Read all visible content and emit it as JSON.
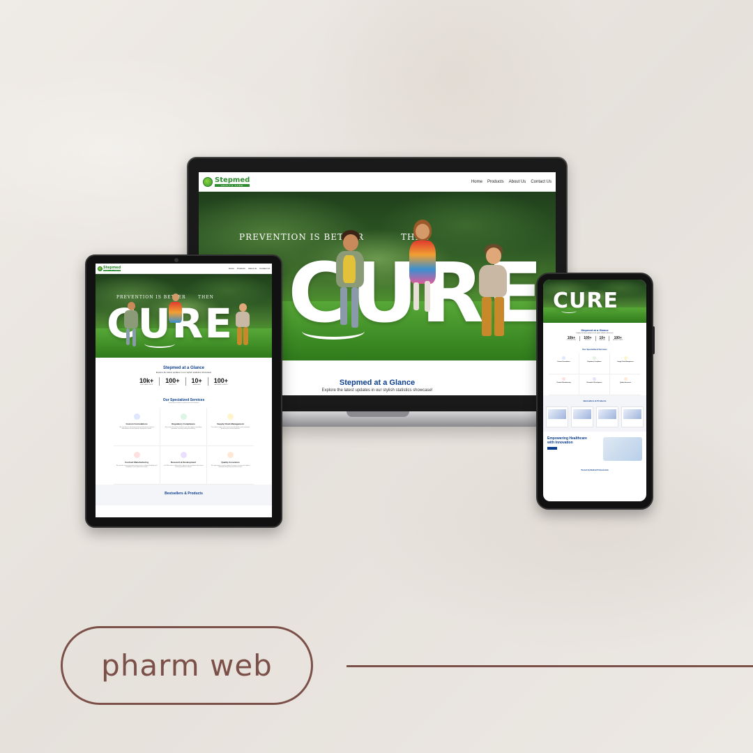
{
  "brand": {
    "name": "Stepmed",
    "tagline": "HEALTH CARE",
    "accent": "#2e8b2f",
    "heading_color": "#0d3f8f"
  },
  "nav": {
    "items": [
      "Home",
      "Products",
      "About Us",
      "Contact Us"
    ]
  },
  "hero": {
    "prevention": "PREVENTION IS BETTER",
    "then": "THEN",
    "cure": "CURE"
  },
  "glance": {
    "title": "Stepmed at a Glance",
    "subtitle": "Explore the latest updates in our stylish statistics showcase!",
    "stats": [
      {
        "value": "10k+",
        "label": "Customer Visits"
      },
      {
        "value": "100+",
        "label": "Products"
      },
      {
        "value": "10+",
        "label": "Branches"
      },
      {
        "value": "100+",
        "label": "Satisfied Clients"
      }
    ]
  },
  "services": {
    "title": "Our Specialized Services",
    "subtitle": "Delivering excellence in pharmaceutical solutions",
    "items": [
      {
        "name": "Custom Formulations",
        "desc": "We specialize in developing tailor-made pharmaceutical formulations to meet specific therapeutic needs.",
        "color": "#dfe7ff"
      },
      {
        "name": "Regulatory Compliance",
        "desc": "We ensure that all our products meet the highest regulatory standards, ensuring safety and efficacy.",
        "color": "#dff5e3"
      },
      {
        "name": "Supply Chain Management",
        "desc": "Our robust supply chain ensures timely delivery and consistent quality across all our products.",
        "color": "#fff4cc"
      },
      {
        "name": "Contract Manufacturing",
        "desc": "We provide contract manufacturing services, offering flexibility and reliability for your production needs.",
        "color": "#ffe0e0"
      },
      {
        "name": "Research & Development",
        "desc": "Our R&D team is dedicated to advancing formulations that meet evolving healthcare needs.",
        "color": "#eadfff"
      },
      {
        "name": "Quality Assurance",
        "desc": "We rigorously test every product to ensure it meets the highest standards of quality and effectiveness.",
        "color": "#ffe9d6"
      }
    ]
  },
  "bestsellers": {
    "title": "Bestsellers & Products"
  },
  "empower": {
    "text": "Empowering Healthcare with Innovation"
  },
  "trusted": {
    "title": "Trusted by Medical Professionals"
  },
  "label": {
    "text": "pharm web",
    "color": "#7a5048"
  }
}
